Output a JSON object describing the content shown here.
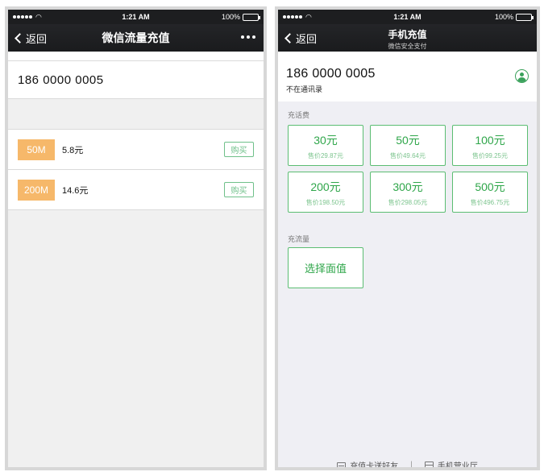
{
  "left": {
    "status": {
      "time": "1:21 AM",
      "battery": "100%"
    },
    "nav": {
      "back_label": "返回",
      "title": "微信流量充值"
    },
    "phone_number": "186  0000  0005",
    "plans": [
      {
        "size": "50M",
        "price": "5.8元",
        "buy_label": "购买"
      },
      {
        "size": "200M",
        "price": "14.6元",
        "buy_label": "购买"
      }
    ]
  },
  "right": {
    "status": {
      "time": "1:21 AM",
      "battery": "100%"
    },
    "nav": {
      "back_label": "返回",
      "title": "手机充值",
      "subtitle": "微信安全支付"
    },
    "phone_number": "186 0000 0005",
    "contact_note": "不在通讯录",
    "call_section_label": "充话费",
    "call_options": [
      {
        "amount": "30元",
        "sale": "售价29.87元"
      },
      {
        "amount": "50元",
        "sale": "售价49.64元"
      },
      {
        "amount": "100元",
        "sale": "售价99.25元"
      },
      {
        "amount": "200元",
        "sale": "售价198.50元"
      },
      {
        "amount": "300元",
        "sale": "售价298.05元"
      },
      {
        "amount": "500元",
        "sale": "售价496.75元"
      }
    ],
    "data_section_label": "充流量",
    "select_value_label": "选择面值",
    "footer": {
      "gift_card": "充值卡送好友",
      "separator": "|",
      "business_hall": "手机营业厅"
    }
  },
  "icons": {
    "back": "chevron-left-icon",
    "more": "more-dots-icon",
    "contact": "contact-icon",
    "gift_card": "card-icon",
    "hall": "store-icon"
  }
}
